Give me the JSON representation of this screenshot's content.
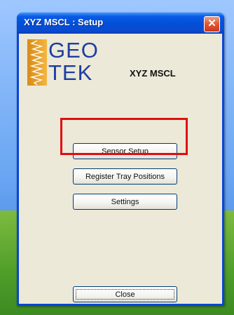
{
  "window": {
    "title": "XYZ MSCL : Setup",
    "close_glyph": "✕"
  },
  "logo": {
    "line1": "GEO",
    "line2": "TEK",
    "band_color": "#e8a22a",
    "text_color": "#1d3ea2"
  },
  "product_name": "XYZ MSCL",
  "buttons": {
    "sensor_setup": "Sensor Setup",
    "register_tray": "Register Tray Positions",
    "settings": "Settings",
    "close": "Close"
  },
  "highlight_color": "#e10e0e"
}
